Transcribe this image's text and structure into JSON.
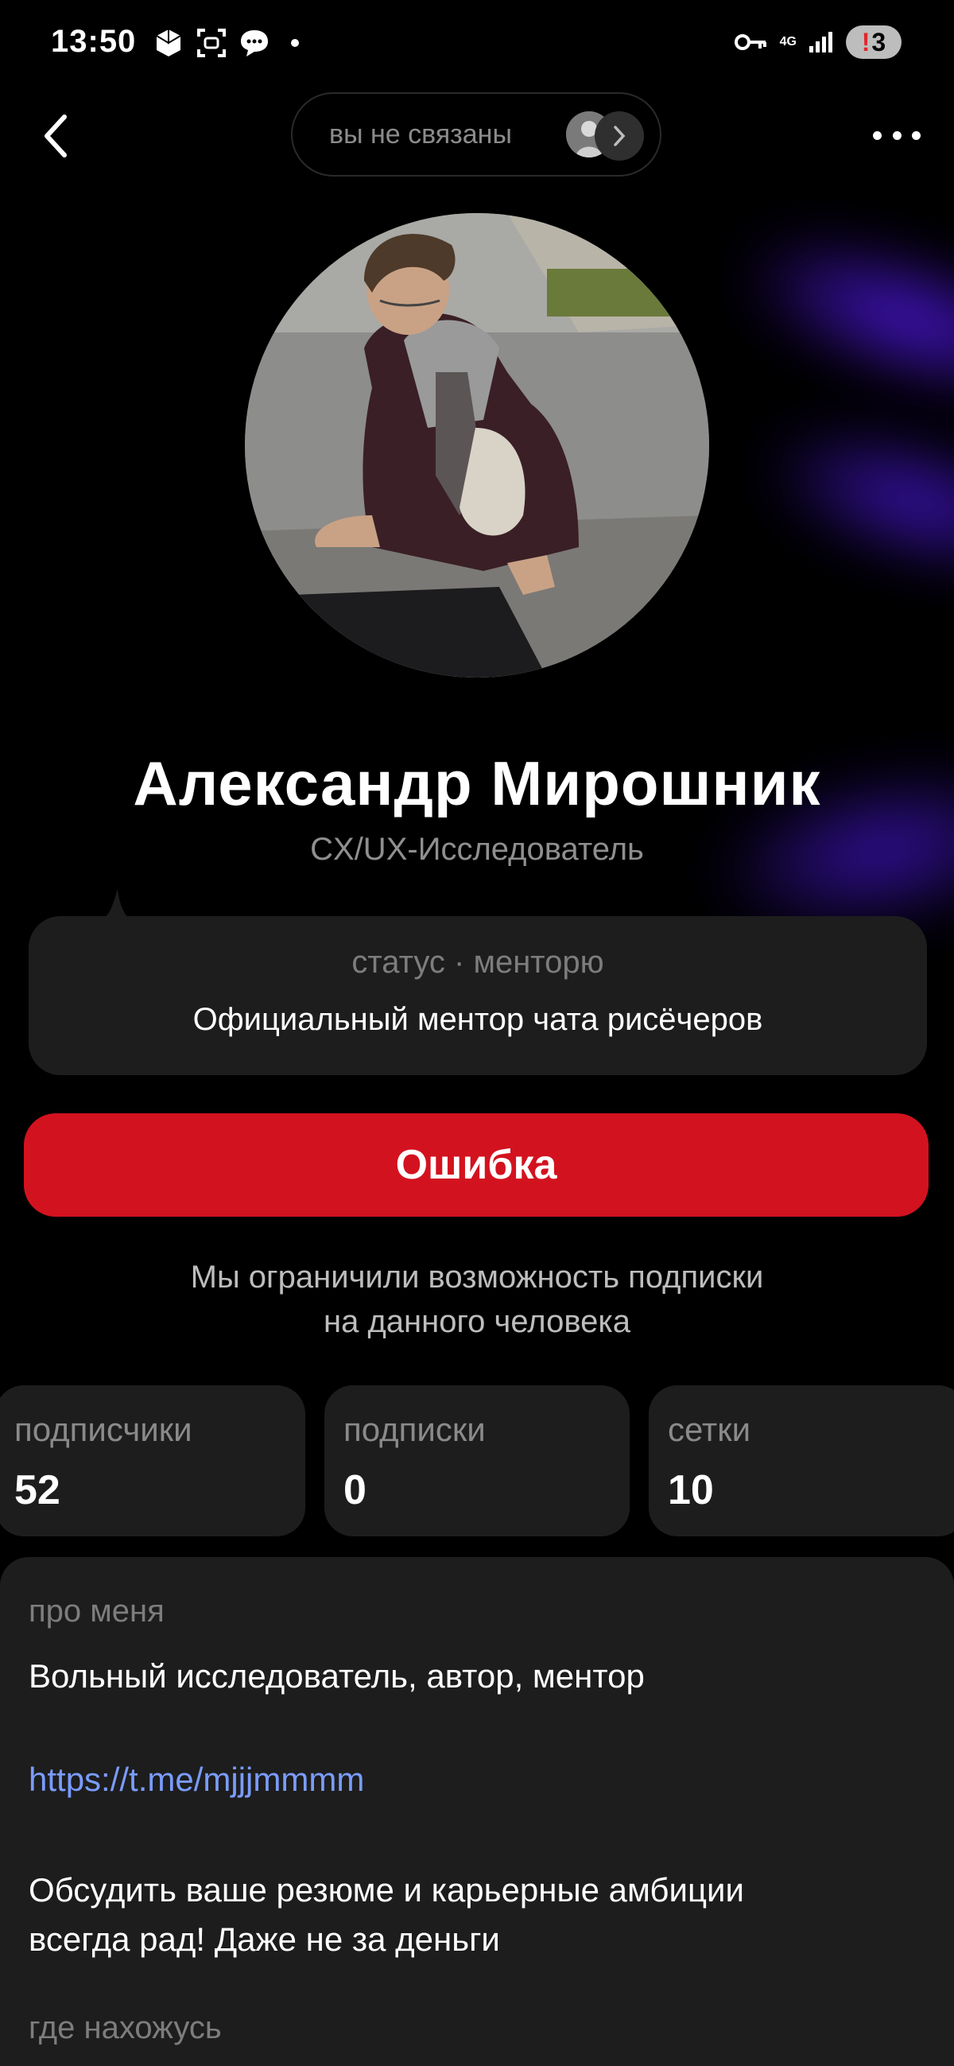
{
  "status_bar": {
    "time": "13:50",
    "network": "4G",
    "battery": "3",
    "battery_alert": "!"
  },
  "header": {
    "connection_label": "вы не связаны",
    "more_icon": "more-horizontal-icon",
    "back_icon": "chevron-left-icon"
  },
  "profile": {
    "name": "Александр Мирошник",
    "role": "CX/UX-Исследователь"
  },
  "status": {
    "label": "статус · менторю",
    "text": "Официальный ментор чата рисёчеров"
  },
  "error_button": {
    "label": "Ошибка",
    "color": "#d3121f"
  },
  "notice": {
    "line1": "Мы ограничили возможность подписки",
    "line2": "на данного человека"
  },
  "stats": [
    {
      "label": "подписчики",
      "value": "52"
    },
    {
      "label": "подписки",
      "value": "0"
    },
    {
      "label": "сетки",
      "value": "10"
    }
  ],
  "about": {
    "label": "про меня",
    "line1": "Вольный исследователь, автор, ментор",
    "link": "https://t.me/mjjjmmmm",
    "line2": "Обсудить ваше резюме и карьерные амбиции",
    "line3": "всегда рад! Даже не за деньги",
    "location_label": "где нахожусь"
  },
  "colors": {
    "background": "#000000",
    "card": "#1d1d1d",
    "accent_glow": "#5a1cff",
    "link": "#7a9cff"
  }
}
